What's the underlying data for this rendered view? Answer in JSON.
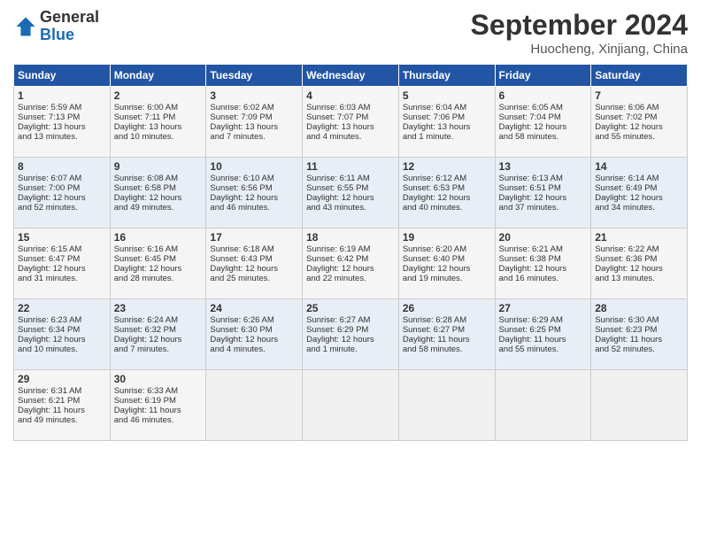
{
  "logo": {
    "line1": "General",
    "line2": "Blue"
  },
  "title": "September 2024",
  "subtitle": "Huocheng, Xinjiang, China",
  "weekdays": [
    "Sunday",
    "Monday",
    "Tuesday",
    "Wednesday",
    "Thursday",
    "Friday",
    "Saturday"
  ],
  "weeks": [
    [
      {
        "day": "1",
        "lines": [
          "Sunrise: 5:59 AM",
          "Sunset: 7:13 PM",
          "Daylight: 13 hours",
          "and 13 minutes."
        ]
      },
      {
        "day": "2",
        "lines": [
          "Sunrise: 6:00 AM",
          "Sunset: 7:11 PM",
          "Daylight: 13 hours",
          "and 10 minutes."
        ]
      },
      {
        "day": "3",
        "lines": [
          "Sunrise: 6:02 AM",
          "Sunset: 7:09 PM",
          "Daylight: 13 hours",
          "and 7 minutes."
        ]
      },
      {
        "day": "4",
        "lines": [
          "Sunrise: 6:03 AM",
          "Sunset: 7:07 PM",
          "Daylight: 13 hours",
          "and 4 minutes."
        ]
      },
      {
        "day": "5",
        "lines": [
          "Sunrise: 6:04 AM",
          "Sunset: 7:06 PM",
          "Daylight: 13 hours",
          "and 1 minute."
        ]
      },
      {
        "day": "6",
        "lines": [
          "Sunrise: 6:05 AM",
          "Sunset: 7:04 PM",
          "Daylight: 12 hours",
          "and 58 minutes."
        ]
      },
      {
        "day": "7",
        "lines": [
          "Sunrise: 6:06 AM",
          "Sunset: 7:02 PM",
          "Daylight: 12 hours",
          "and 55 minutes."
        ]
      }
    ],
    [
      {
        "day": "8",
        "lines": [
          "Sunrise: 6:07 AM",
          "Sunset: 7:00 PM",
          "Daylight: 12 hours",
          "and 52 minutes."
        ]
      },
      {
        "day": "9",
        "lines": [
          "Sunrise: 6:08 AM",
          "Sunset: 6:58 PM",
          "Daylight: 12 hours",
          "and 49 minutes."
        ]
      },
      {
        "day": "10",
        "lines": [
          "Sunrise: 6:10 AM",
          "Sunset: 6:56 PM",
          "Daylight: 12 hours",
          "and 46 minutes."
        ]
      },
      {
        "day": "11",
        "lines": [
          "Sunrise: 6:11 AM",
          "Sunset: 6:55 PM",
          "Daylight: 12 hours",
          "and 43 minutes."
        ]
      },
      {
        "day": "12",
        "lines": [
          "Sunrise: 6:12 AM",
          "Sunset: 6:53 PM",
          "Daylight: 12 hours",
          "and 40 minutes."
        ]
      },
      {
        "day": "13",
        "lines": [
          "Sunrise: 6:13 AM",
          "Sunset: 6:51 PM",
          "Daylight: 12 hours",
          "and 37 minutes."
        ]
      },
      {
        "day": "14",
        "lines": [
          "Sunrise: 6:14 AM",
          "Sunset: 6:49 PM",
          "Daylight: 12 hours",
          "and 34 minutes."
        ]
      }
    ],
    [
      {
        "day": "15",
        "lines": [
          "Sunrise: 6:15 AM",
          "Sunset: 6:47 PM",
          "Daylight: 12 hours",
          "and 31 minutes."
        ]
      },
      {
        "day": "16",
        "lines": [
          "Sunrise: 6:16 AM",
          "Sunset: 6:45 PM",
          "Daylight: 12 hours",
          "and 28 minutes."
        ]
      },
      {
        "day": "17",
        "lines": [
          "Sunrise: 6:18 AM",
          "Sunset: 6:43 PM",
          "Daylight: 12 hours",
          "and 25 minutes."
        ]
      },
      {
        "day": "18",
        "lines": [
          "Sunrise: 6:19 AM",
          "Sunset: 6:42 PM",
          "Daylight: 12 hours",
          "and 22 minutes."
        ]
      },
      {
        "day": "19",
        "lines": [
          "Sunrise: 6:20 AM",
          "Sunset: 6:40 PM",
          "Daylight: 12 hours",
          "and 19 minutes."
        ]
      },
      {
        "day": "20",
        "lines": [
          "Sunrise: 6:21 AM",
          "Sunset: 6:38 PM",
          "Daylight: 12 hours",
          "and 16 minutes."
        ]
      },
      {
        "day": "21",
        "lines": [
          "Sunrise: 6:22 AM",
          "Sunset: 6:36 PM",
          "Daylight: 12 hours",
          "and 13 minutes."
        ]
      }
    ],
    [
      {
        "day": "22",
        "lines": [
          "Sunrise: 6:23 AM",
          "Sunset: 6:34 PM",
          "Daylight: 12 hours",
          "and 10 minutes."
        ]
      },
      {
        "day": "23",
        "lines": [
          "Sunrise: 6:24 AM",
          "Sunset: 6:32 PM",
          "Daylight: 12 hours",
          "and 7 minutes."
        ]
      },
      {
        "day": "24",
        "lines": [
          "Sunrise: 6:26 AM",
          "Sunset: 6:30 PM",
          "Daylight: 12 hours",
          "and 4 minutes."
        ]
      },
      {
        "day": "25",
        "lines": [
          "Sunrise: 6:27 AM",
          "Sunset: 6:29 PM",
          "Daylight: 12 hours",
          "and 1 minute."
        ]
      },
      {
        "day": "26",
        "lines": [
          "Sunrise: 6:28 AM",
          "Sunset: 6:27 PM",
          "Daylight: 11 hours",
          "and 58 minutes."
        ]
      },
      {
        "day": "27",
        "lines": [
          "Sunrise: 6:29 AM",
          "Sunset: 6:25 PM",
          "Daylight: 11 hours",
          "and 55 minutes."
        ]
      },
      {
        "day": "28",
        "lines": [
          "Sunrise: 6:30 AM",
          "Sunset: 6:23 PM",
          "Daylight: 11 hours",
          "and 52 minutes."
        ]
      }
    ],
    [
      {
        "day": "29",
        "lines": [
          "Sunrise: 6:31 AM",
          "Sunset: 6:21 PM",
          "Daylight: 11 hours",
          "and 49 minutes."
        ]
      },
      {
        "day": "30",
        "lines": [
          "Sunrise: 6:33 AM",
          "Sunset: 6:19 PM",
          "Daylight: 11 hours",
          "and 46 minutes."
        ]
      },
      {
        "day": "",
        "lines": []
      },
      {
        "day": "",
        "lines": []
      },
      {
        "day": "",
        "lines": []
      },
      {
        "day": "",
        "lines": []
      },
      {
        "day": "",
        "lines": []
      }
    ]
  ]
}
